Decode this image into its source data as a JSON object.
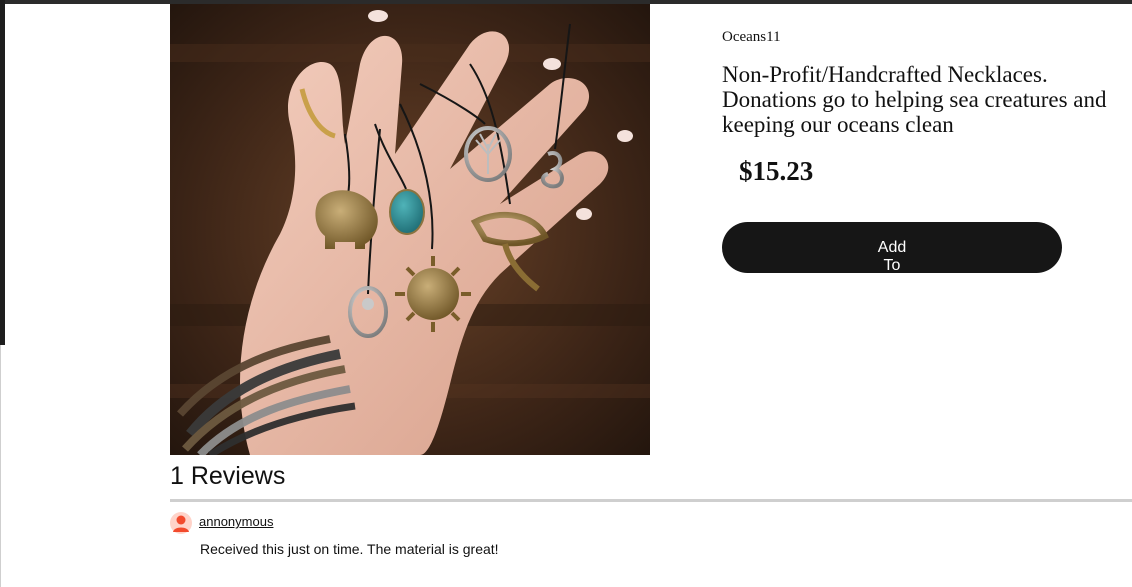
{
  "product": {
    "seller": "Oceans11",
    "title": "Non-Profit/Handcrafted Necklaces. Donations go to helping sea creatures and keeping our oceans clean",
    "price": "$15.23",
    "add_button_label": "Add To",
    "image_alt": "Hand holding assorted pendant necklaces"
  },
  "reviews": {
    "heading": "1 Reviews",
    "items": [
      {
        "author": "annonymous",
        "text": "Received this just on time. The material is great!"
      }
    ]
  },
  "colors": {
    "button_bg": "#161616",
    "avatar_accent": "#f24a2d",
    "divider": "#cfcfcf"
  },
  "icons": {
    "avatar": "user-avatar-icon"
  }
}
